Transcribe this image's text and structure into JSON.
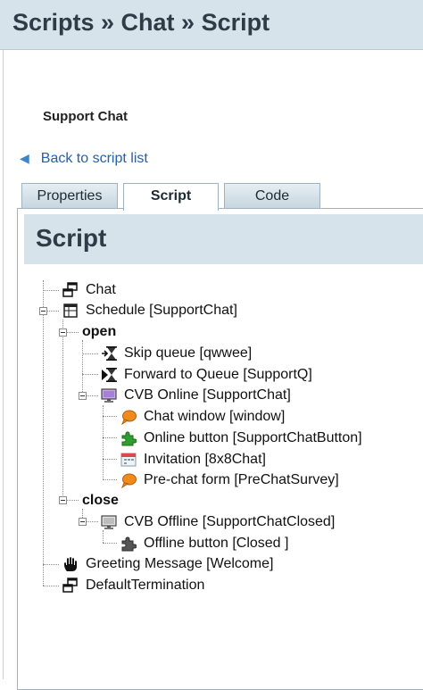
{
  "header": {
    "breadcrumb": "Scripts » Chat » Script"
  },
  "subtitle": "Support Chat",
  "back_link": {
    "label": "Back to script list"
  },
  "tabs": [
    {
      "label": "Properties",
      "active": false
    },
    {
      "label": "Script",
      "active": true
    },
    {
      "label": "Code",
      "active": false
    }
  ],
  "panel": {
    "title": "Script"
  },
  "tree": {
    "chat": "Chat",
    "schedule": "Schedule [SupportChat]",
    "open": "open",
    "skip_queue": "Skip queue [qwwee]",
    "forward_queue": "Forward to Queue [SupportQ]",
    "cvb_online": "CVB Online [SupportChat]",
    "chat_window": "Chat window [window]",
    "online_button": "Online button [SupportChatButton]",
    "invitation": "Invitation [8x8Chat]",
    "prechat_form": "Pre-chat form [PreChatSurvey]",
    "close": "close",
    "cvb_offline": "CVB Offline [SupportChatClosed]",
    "offline_button": "Offline button [Closed ]",
    "greeting": "Greeting Message [Welcome]",
    "default_termination": "DefaultTermination"
  },
  "icons": {
    "chat": "window-link-icon",
    "schedule": "calendar-icon",
    "skip_queue": "hourglass-arrow-icon",
    "forward_queue": "hourglass-forward-icon",
    "cvb_online": "monitor-online-icon",
    "chat_window": "speech-bubble-icon",
    "online_button": "puzzle-green-icon",
    "invitation": "calendar-card-icon",
    "prechat_form": "speech-bubble-icon",
    "cvb_offline": "monitor-offline-icon",
    "offline_button": "puzzle-gray-icon",
    "greeting": "hand-icon",
    "default_termination": "window-link-icon"
  },
  "colors": {
    "header_bg": "#d6e3ea",
    "link": "#2560a8",
    "bubble": "#f08a1c",
    "puzzle_online": "#2e9e2e",
    "puzzle_offline": "#555555"
  }
}
